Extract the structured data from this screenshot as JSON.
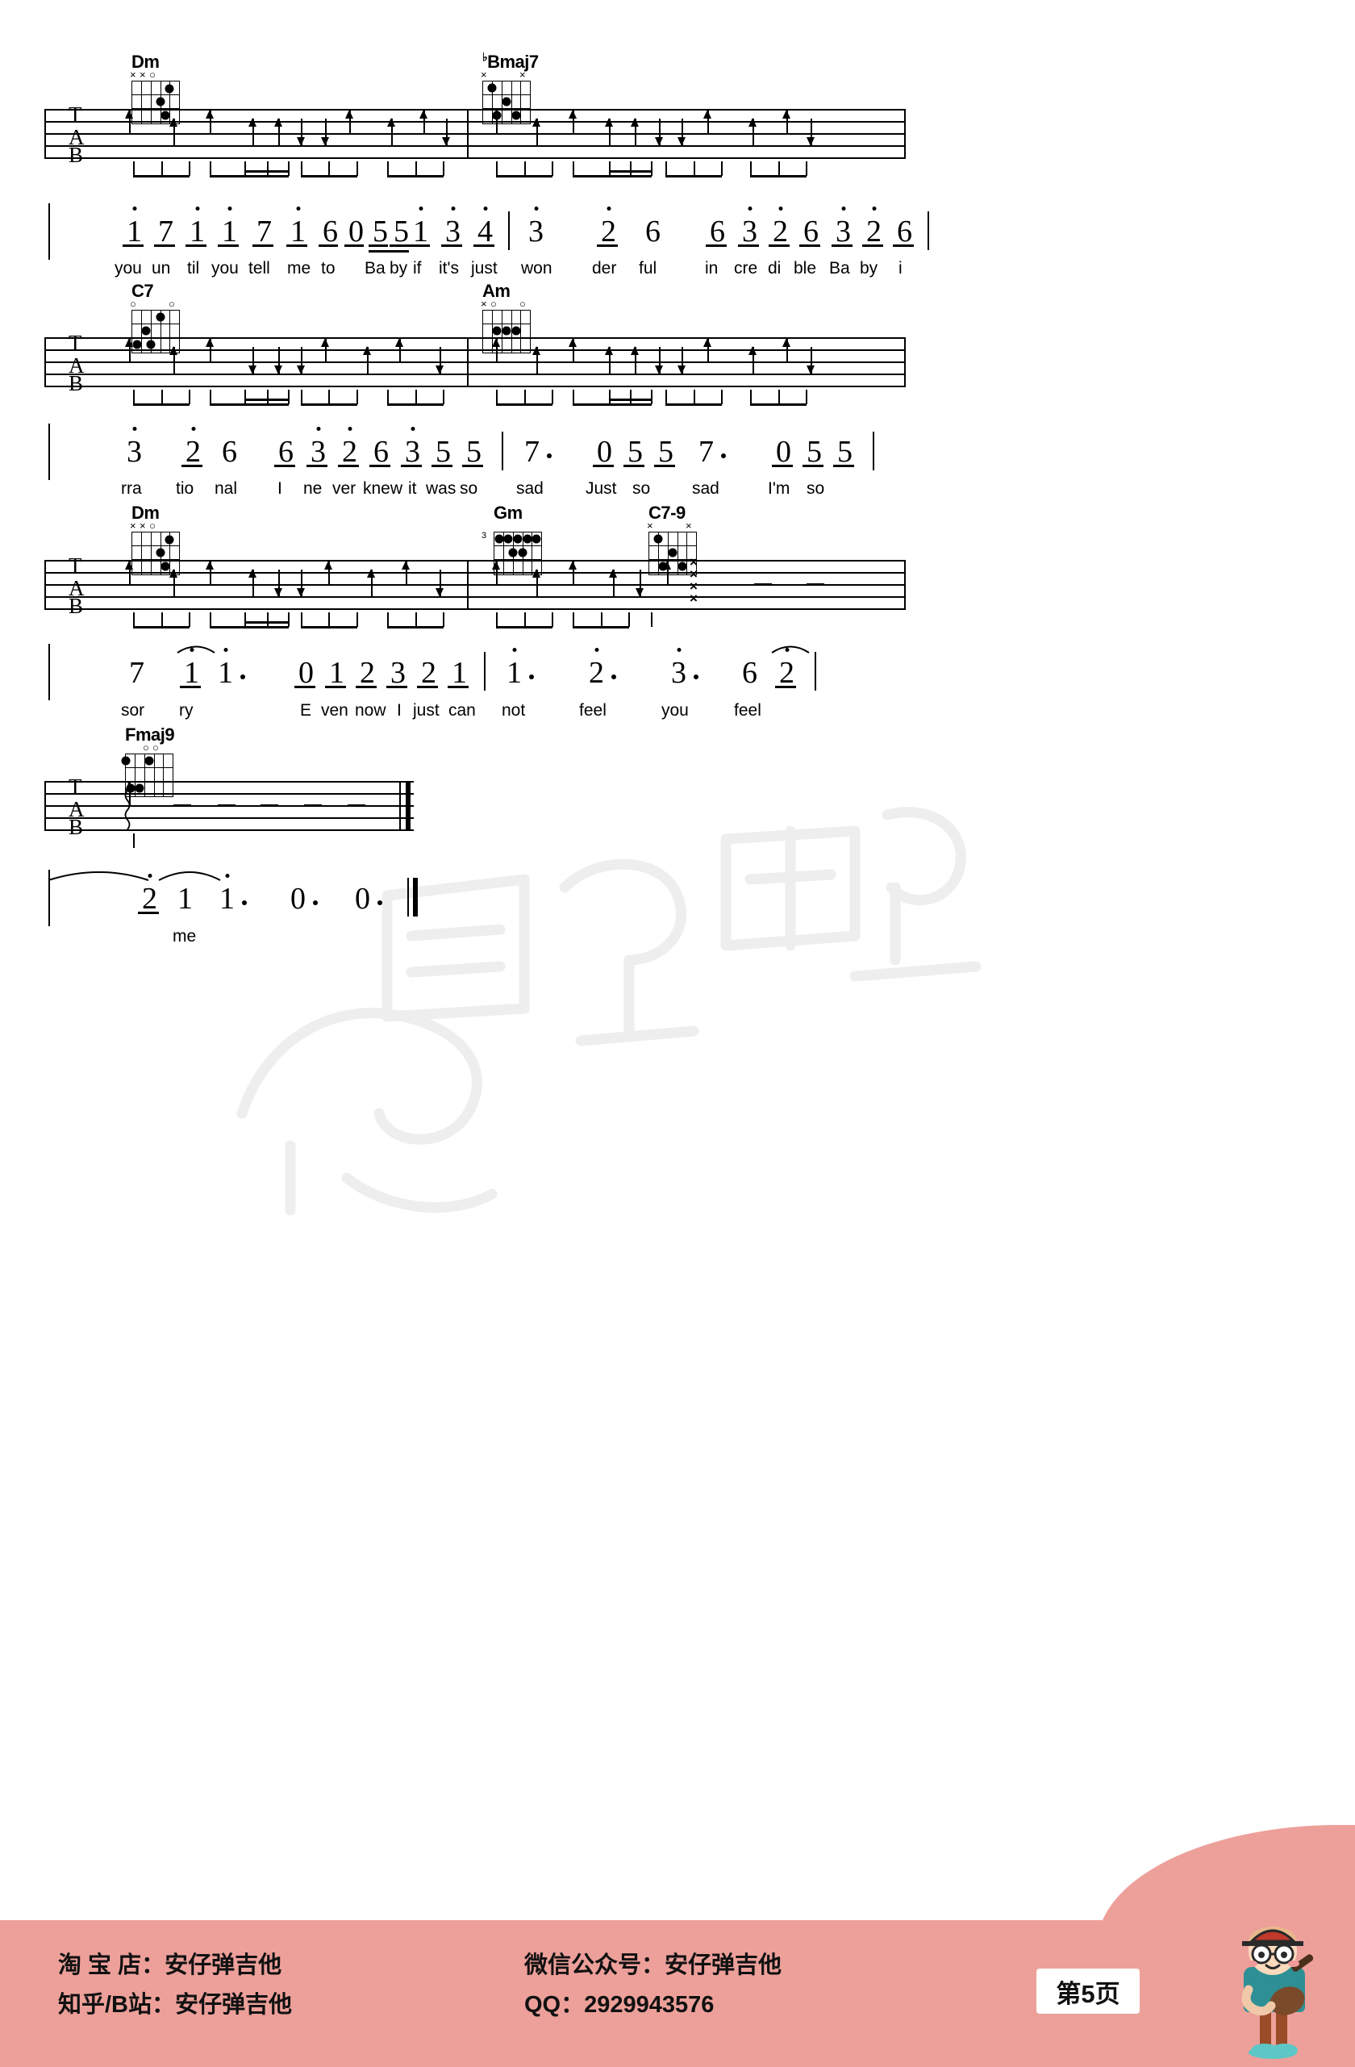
{
  "document": {
    "type": "guitar-tab-sheet-music",
    "page_label": "第5页"
  },
  "systems": [
    {
      "id": "system-1",
      "chords": [
        {
          "name": "Dm",
          "flat": false,
          "marks": "xxo",
          "frets": [
            [
              6,
              "x"
            ],
            [
              5,
              "x"
            ],
            [
              4,
              "o"
            ],
            [
              1,
              1
            ],
            [
              2,
              3
            ],
            [
              3,
              2
            ]
          ]
        },
        {
          "name": "Bmaj7",
          "flat": true,
          "marks": "x--x",
          "frets": []
        }
      ],
      "melody": [
        {
          "n": "1",
          "oct": "up",
          "lyric": "you"
        },
        {
          "n": "7",
          "oct": "",
          "lyric": "un"
        },
        {
          "n": "1",
          "oct": "up",
          "lyric": "til"
        },
        {
          "n": "1",
          "oct": "up",
          "lyric": "you"
        },
        {
          "n": "7",
          "oct": "",
          "lyric": "tell"
        },
        {
          "n": "1",
          "oct": "up",
          "lyric": "me"
        },
        {
          "n": "6",
          "oct": "",
          "lyric": "to"
        },
        {
          "n": "0",
          "oct": "",
          "lyric": ""
        },
        {
          "n": "5",
          "oct": "",
          "lyric": "Ba"
        },
        {
          "n": "5",
          "oct": "",
          "lyric": "by"
        },
        {
          "n": "1",
          "oct": "up",
          "lyric": "if"
        },
        {
          "n": "3",
          "oct": "up",
          "lyric": "it's"
        },
        {
          "n": "4",
          "oct": "up",
          "lyric": "just"
        },
        {
          "n": "3",
          "oct": "up",
          "lyric": "won"
        },
        {
          "n": "2",
          "oct": "up",
          "lyric": "der"
        },
        {
          "n": "6",
          "oct": "",
          "lyric": "ful"
        },
        {
          "n": "6",
          "oct": "",
          "lyric": "in"
        },
        {
          "n": "3",
          "oct": "up",
          "lyric": "cre"
        },
        {
          "n": "2",
          "oct": "up",
          "lyric": "di"
        },
        {
          "n": "6",
          "oct": "",
          "lyric": "ble"
        },
        {
          "n": "3",
          "oct": "up",
          "lyric": "Ba"
        },
        {
          "n": "2",
          "oct": "up",
          "lyric": "by"
        },
        {
          "n": "6",
          "oct": "",
          "lyric": "i"
        }
      ]
    },
    {
      "id": "system-2",
      "chords": [
        {
          "name": "C7",
          "flat": false,
          "marks": "o--o",
          "frets": []
        },
        {
          "name": "Am",
          "flat": false,
          "marks": "xo--o",
          "frets": []
        }
      ],
      "melody": [
        {
          "n": "3",
          "oct": "up",
          "lyric": "rra"
        },
        {
          "n": "2",
          "oct": "up",
          "lyric": "tio"
        },
        {
          "n": "6",
          "oct": "",
          "lyric": "nal"
        },
        {
          "n": "6",
          "oct": "",
          "lyric": "I"
        },
        {
          "n": "3",
          "oct": "up",
          "lyric": "ne"
        },
        {
          "n": "2",
          "oct": "up",
          "lyric": "ver"
        },
        {
          "n": "6",
          "oct": "",
          "lyric": "knew"
        },
        {
          "n": "3",
          "oct": "up",
          "lyric": "it"
        },
        {
          "n": "5",
          "oct": "",
          "lyric": "was"
        },
        {
          "n": "5",
          "oct": "",
          "lyric": "so"
        },
        {
          "n": "7",
          "oct": "",
          "lyric": "sad",
          "dot": true
        },
        {
          "n": "0",
          "oct": "",
          "lyric": ""
        },
        {
          "n": "5",
          "oct": "",
          "lyric": "Just"
        },
        {
          "n": "5",
          "oct": "",
          "lyric": "so"
        },
        {
          "n": "7",
          "oct": "",
          "lyric": "sad",
          "dot": true
        },
        {
          "n": "0",
          "oct": "",
          "lyric": ""
        },
        {
          "n": "5",
          "oct": "",
          "lyric": "I'm"
        },
        {
          "n": "5",
          "oct": "",
          "lyric": "so"
        }
      ]
    },
    {
      "id": "system-3",
      "chords": [
        {
          "name": "Dm",
          "flat": false,
          "marks": "xxo",
          "frets": []
        },
        {
          "name": "Gm",
          "flat": false,
          "marks": "",
          "fret_label": "3",
          "frets": []
        },
        {
          "name": "C7-9",
          "flat": false,
          "marks": "x--x",
          "frets": []
        }
      ],
      "melody": [
        {
          "n": "7",
          "oct": "",
          "lyric": "sor"
        },
        {
          "n": "1",
          "oct": "up",
          "lyric": "ry"
        },
        {
          "n": "1",
          "oct": "up",
          "lyric": "",
          "dot": true
        },
        {
          "n": "0",
          "oct": "",
          "lyric": "E"
        },
        {
          "n": "1",
          "oct": "",
          "lyric": "ven"
        },
        {
          "n": "2",
          "oct": "",
          "lyric": "now"
        },
        {
          "n": "3",
          "oct": "",
          "lyric": "I"
        },
        {
          "n": "2",
          "oct": "",
          "lyric": "just"
        },
        {
          "n": "1",
          "oct": "",
          "lyric": "can"
        },
        {
          "n": "1",
          "oct": "up",
          "lyric": "not",
          "dot": true
        },
        {
          "n": "2",
          "oct": "up",
          "lyric": "feel",
          "dot": true
        },
        {
          "n": "3",
          "oct": "up",
          "lyric": "you",
          "dot": true
        },
        {
          "n": "6",
          "oct": "",
          "lyric": "feel"
        },
        {
          "n": "2",
          "oct": "up",
          "lyric": ""
        }
      ]
    },
    {
      "id": "system-4",
      "chords": [
        {
          "name": "Fmaj9",
          "flat": false,
          "marks": "-oo",
          "frets": []
        }
      ],
      "melody": [
        {
          "n": "2",
          "oct": "up",
          "lyric": ""
        },
        {
          "n": "1",
          "oct": "",
          "lyric": "me"
        },
        {
          "n": "1",
          "oct": "up",
          "lyric": "",
          "dot": true
        },
        {
          "n": "0",
          "oct": "",
          "lyric": "",
          "dot": true
        },
        {
          "n": "0",
          "oct": "",
          "lyric": "",
          "dot": true
        }
      ]
    }
  ],
  "tab_letters": [
    "T",
    "A",
    "B"
  ],
  "footer": {
    "taobao_label": "淘 宝 店：安仔弹吉他",
    "zhihu_label": "知乎/B站：安仔弹吉他",
    "wechat_label": "微信公众号：安仔弹吉他",
    "qq_label": "QQ：2929943576",
    "page_label": "第5页",
    "background_color": "#eda09a"
  }
}
